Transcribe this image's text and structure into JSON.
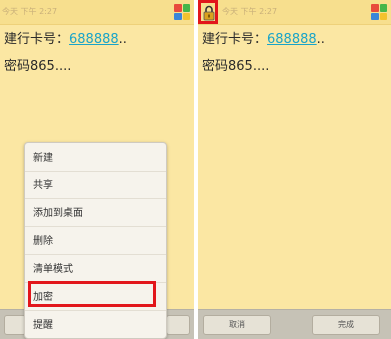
{
  "left": {
    "time": "今天 下午 2:27",
    "card_label": "建行卡号：",
    "card_number": "688888",
    "card_suffix": "..",
    "password": "密码865....",
    "menu_items": [
      {
        "label": "新建"
      },
      {
        "label": "共享"
      },
      {
        "label": "添加到桌面"
      },
      {
        "label": "删除"
      },
      {
        "label": "清单模式"
      },
      {
        "label": "加密"
      },
      {
        "label": "提醒"
      }
    ]
  },
  "right": {
    "time": "今天 下午 2:27",
    "card_label": "建行卡号：",
    "card_number": "688888",
    "card_suffix": "..",
    "password": "密码865....",
    "cancel_label": "取消",
    "done_label": "完成"
  },
  "colors": {
    "note_bg": "#fbe7a3",
    "highlight": "#e2161b",
    "link": "#1aa4c8",
    "tile_colors": [
      "#e84a3c",
      "#45b649",
      "#3a86d8",
      "#f2c22e"
    ]
  },
  "icons": {
    "lock": "lock-icon",
    "color_picker": "color-grid-icon"
  }
}
